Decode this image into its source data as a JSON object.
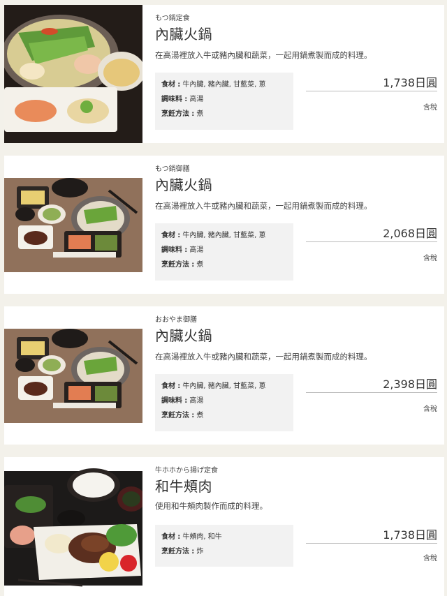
{
  "items": [
    {
      "subtitle": "もつ鍋定食",
      "title": "內臟火鍋",
      "description": "在高湯裡放入牛或豬內臟和蔬菜，一起用鍋煮製而成的料理。",
      "info": [
        {
          "key": "食材",
          "sep": ":",
          "value": "牛內臟, 豬內臟, 甘藍菜, 蔥"
        },
        {
          "key": "調味料",
          "sep": ":",
          "value": "高湯"
        },
        {
          "key": "烹飪方法",
          "sep": ":",
          "value": "煮"
        }
      ],
      "price": "1,738日圓",
      "tax": "含稅"
    },
    {
      "subtitle": "もつ鍋御膳",
      "title": "內臟火鍋",
      "description": "在高湯裡放入牛或豬內臟和蔬菜，一起用鍋煮製而成的料理。",
      "info": [
        {
          "key": "食材",
          "sep": ":",
          "value": "牛內臟, 豬內臟, 甘藍菜, 蔥"
        },
        {
          "key": "調味料",
          "sep": ":",
          "value": "高湯"
        },
        {
          "key": "烹飪方法",
          "sep": ":",
          "value": "煮"
        }
      ],
      "price": "2,068日圓",
      "tax": "含稅"
    },
    {
      "subtitle": "おおやま御膳",
      "title": "內臟火鍋",
      "description": "在高湯裡放入牛或豬內臟和蔬菜，一起用鍋煮製而成的料理。",
      "info": [
        {
          "key": "食材",
          "sep": ":",
          "value": "牛內臟, 豬內臟, 甘藍菜, 蔥"
        },
        {
          "key": "調味料",
          "sep": ":",
          "value": "高湯"
        },
        {
          "key": "烹飪方法",
          "sep": ":",
          "value": "煮"
        }
      ],
      "price": "2,398日圓",
      "tax": "含稅"
    },
    {
      "subtitle": "牛ホホから揚げ定食",
      "title": "和牛頰肉",
      "description": "使用和牛頰肉製作而成的料理。",
      "info": [
        {
          "key": "食材",
          "sep": ":",
          "value": "牛頰肉, 和牛"
        },
        {
          "key": "烹飪方法",
          "sep": ":",
          "value": "炸"
        }
      ],
      "price": "1,738日圓",
      "tax": "含稅"
    }
  ],
  "colors": {
    "page_background": "#f3f1ea",
    "card_background": "#ffffff",
    "info_box": "#f2f2f2"
  }
}
